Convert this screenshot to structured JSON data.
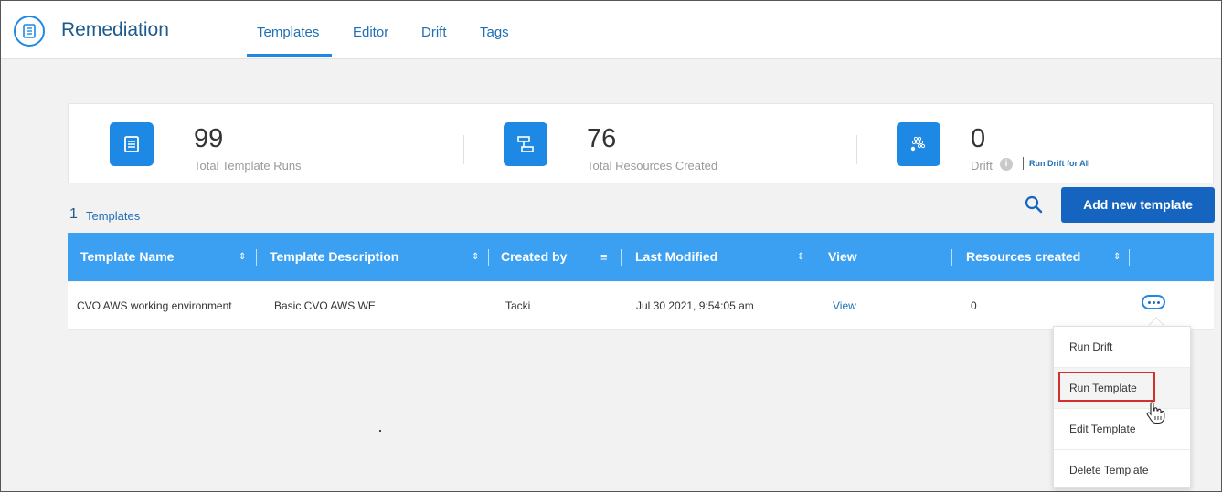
{
  "app": {
    "title": "Remediation",
    "tabs": [
      {
        "label": "Templates",
        "active": true
      },
      {
        "label": "Editor",
        "active": false
      },
      {
        "label": "Drift",
        "active": false
      },
      {
        "label": "Tags",
        "active": false
      }
    ]
  },
  "stats": {
    "runs": {
      "value": "99",
      "label": "Total Template Runs",
      "icon": "document-icon"
    },
    "resources": {
      "value": "76",
      "label": "Total Resources Created",
      "icon": "hierarchy-icon"
    },
    "drift": {
      "value": "0",
      "label": "Drift",
      "icon": "drift-dots-icon",
      "run_all_link": "Run Drift for All"
    }
  },
  "templates": {
    "count": "1",
    "label": "Templates",
    "add_button": "Add new template"
  },
  "table": {
    "columns": [
      "Template Name",
      "Template Description",
      "Created by",
      "Last Modified",
      "View",
      "Resources created"
    ],
    "rows": [
      {
        "name": "CVO AWS working environment",
        "description": "Basic CVO AWS WE",
        "created_by": "Tacki",
        "last_modified": "Jul 30 2021, 9:54:05 am",
        "view": "View",
        "resources": "0"
      }
    ]
  },
  "menu": {
    "items": [
      "Run Drift",
      "Run Template",
      "Edit Template",
      "Delete Template"
    ],
    "highlighted": "Run Template"
  },
  "colors": {
    "accent": "#1e88e5",
    "header_bg": "#3ba0f2",
    "button_bg": "#1565c0",
    "highlight_box": "#d32f2f"
  }
}
